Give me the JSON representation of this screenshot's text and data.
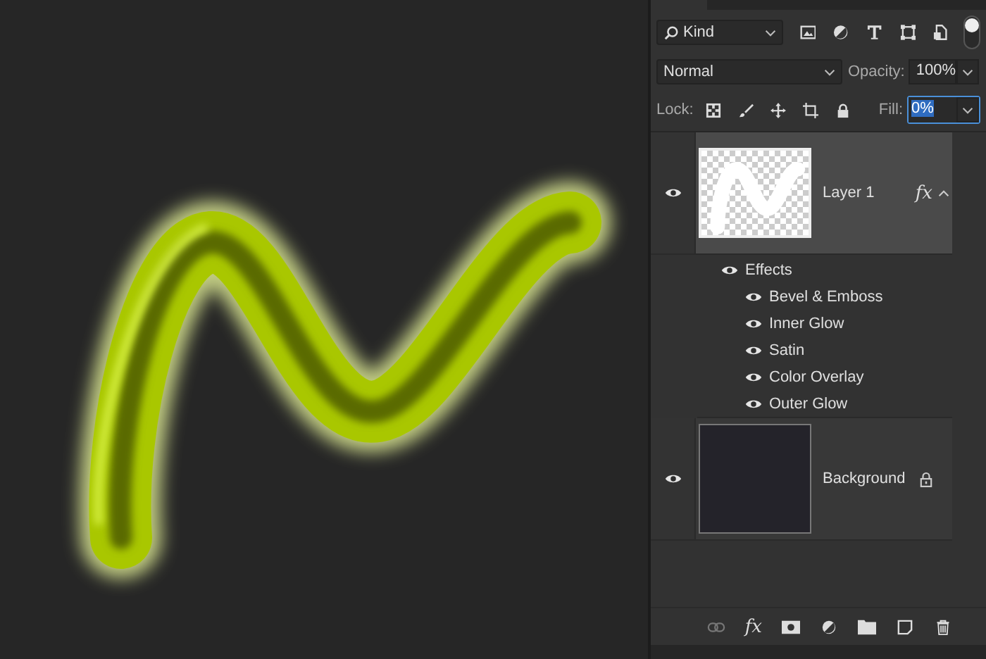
{
  "filter": {
    "kind": "Kind"
  },
  "blend_mode": "Normal",
  "opacity": {
    "label": "Opacity:",
    "value": "100%"
  },
  "lock": {
    "label": "Lock:"
  },
  "fill": {
    "label": "Fill:",
    "value": "0%",
    "focused": true
  },
  "layers": [
    {
      "kind": "artwork",
      "name": "Layer 1",
      "visible": true,
      "selected": true,
      "fx": "fx",
      "expanded": true,
      "effects_label": "Effects",
      "effects_visible": true,
      "effects": [
        {
          "name": "Bevel & Emboss",
          "visible": true
        },
        {
          "name": "Inner Glow",
          "visible": true
        },
        {
          "name": "Satin",
          "visible": true
        },
        {
          "name": "Color Overlay",
          "visible": true
        },
        {
          "name": "Outer Glow",
          "visible": true
        }
      ]
    },
    {
      "kind": "solid",
      "name": "Background",
      "visible": true,
      "selected": false,
      "locked": true
    }
  ],
  "toolbar": {
    "fx": "fx"
  }
}
